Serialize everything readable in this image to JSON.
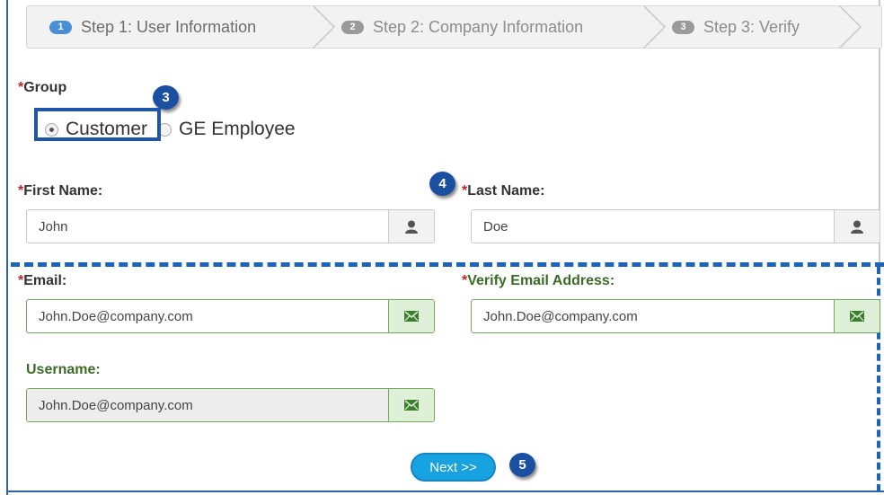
{
  "wizard": {
    "steps": [
      {
        "num": "1",
        "label": "Step 1: User Information"
      },
      {
        "num": "2",
        "label": "Step 2: Company Information"
      },
      {
        "num": "3",
        "label": "Step 3: Verify"
      }
    ]
  },
  "required_mark": "*",
  "group": {
    "label": "Group",
    "options": [
      "Customer",
      "GE Employee"
    ],
    "selected": "Customer"
  },
  "markers": [
    "3",
    "4",
    "5"
  ],
  "first_name": {
    "label": "First Name:",
    "value": "John",
    "icon": "user-icon"
  },
  "last_name": {
    "label": "Last Name:",
    "value": "Doe",
    "icon": "user-icon"
  },
  "email": {
    "label": "Email:",
    "value": "John.Doe@company.com",
    "icon": "envelope-icon"
  },
  "verify_email": {
    "label": "Verify Email Address:",
    "value": "John.Doe@company.com",
    "icon": "envelope-icon"
  },
  "username": {
    "label": "Username:",
    "value": "John.Doe@company.com",
    "icon": "envelope-icon"
  },
  "next_button": "Next >>",
  "colors": {
    "required": "#c0262d",
    "highlight": "#1d56a5",
    "valid_green": "#3a6b27",
    "button": "#17a2e0"
  }
}
